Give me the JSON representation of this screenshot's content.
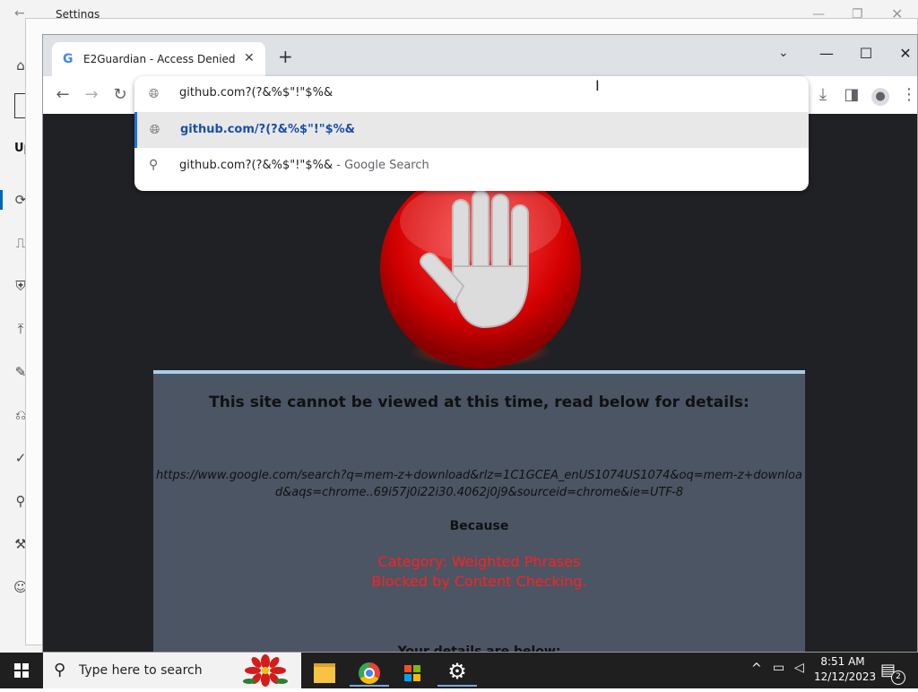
{
  "settings_window": {
    "title": "Settings",
    "partial_label": "Up"
  },
  "chrome": {
    "tab_title": "E2Guardian - Access Denied",
    "favicon": "G",
    "omnibox": {
      "input_value": "github.com?(?&%$\"!\"$%&",
      "suggestions": [
        {
          "icon": "globe-icon",
          "text": "github.com/?(?&%$\"!\"$%&"
        },
        {
          "icon": "search-icon",
          "text": "github.com?(?&%$\"!\"$%&",
          "suffix": " - Google Search"
        }
      ]
    }
  },
  "page": {
    "heading": "This site cannot be viewed at this time, read below for details:",
    "blocked_url": "https://www.google.com/search?q=mem-z+download&rlz=1C1GCEA_enUS1074US1074&oq=mem-z+download&aqs=chrome..69i57j0i22i30.4062j0j9&sourceid=chrome&ie=UTF-8",
    "because": "Because",
    "category_line": "Category: Weighted Phrases",
    "blocked_line": "Blocked by Content Checking.",
    "details": "Your details are below:"
  },
  "taskbar": {
    "search_placeholder": "Type here to search",
    "time": "8:51 AM",
    "date": "12/12/2023",
    "notification_count": "2"
  },
  "colors": {
    "accent": "#1a73e8",
    "alert": "#ff2020",
    "panel": "#4b5564",
    "page_bg": "#202124"
  }
}
